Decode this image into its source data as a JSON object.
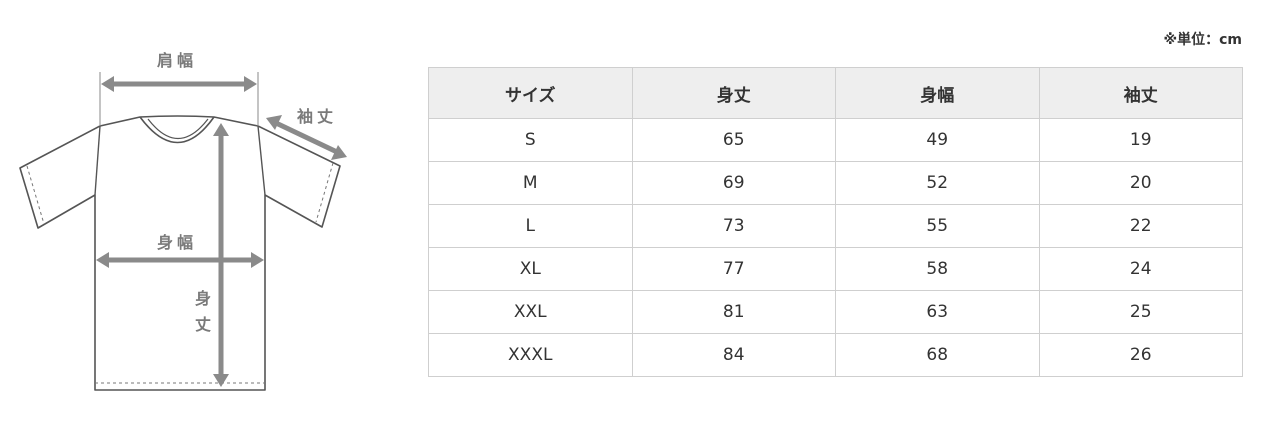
{
  "diagram": {
    "labels": {
      "shoulder_width": "肩幅",
      "sleeve_length": "袖丈",
      "body_width": "身幅",
      "body_length": "身丈"
    }
  },
  "unit_note": "※単位：cm",
  "size_table": {
    "headers": [
      "サイズ",
      "身丈",
      "身幅",
      "袖丈"
    ],
    "rows": [
      [
        "S",
        "65",
        "49",
        "19"
      ],
      [
        "M",
        "69",
        "52",
        "20"
      ],
      [
        "L",
        "73",
        "55",
        "22"
      ],
      [
        "XL",
        "77",
        "58",
        "24"
      ],
      [
        "XXL",
        "81",
        "63",
        "25"
      ],
      [
        "XXXL",
        "84",
        "68",
        "26"
      ]
    ]
  }
}
